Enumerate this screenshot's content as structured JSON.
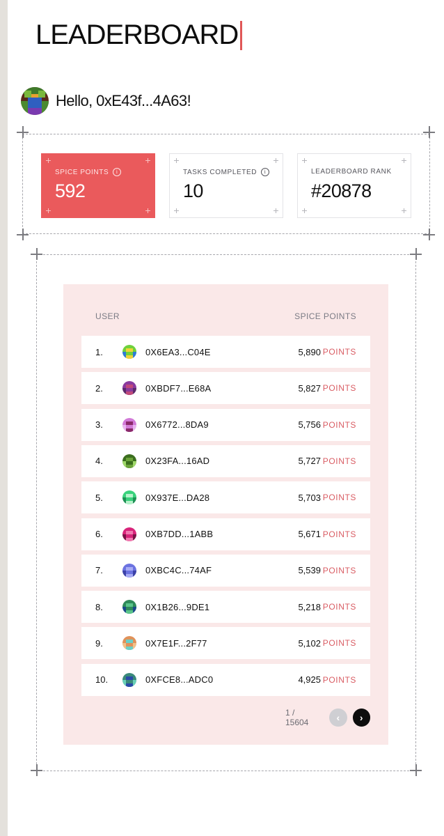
{
  "header": {
    "title": "LEADERBOARD"
  },
  "greeting": {
    "text": "Hello, 0xE43f...4A63!"
  },
  "stats": [
    {
      "label": "SPICE POINTS",
      "value": "592"
    },
    {
      "label": "TASKS COMPLETED",
      "value": "10"
    },
    {
      "label": "LEADERBOARD RANK",
      "value": "#20878"
    }
  ],
  "table": {
    "columns": [
      "USER",
      "SPICE POINTS"
    ],
    "unit": "POINTS",
    "rows": [
      {
        "rank": "1.",
        "user": "0X6EA3...C04E",
        "points": "5,890"
      },
      {
        "rank": "2.",
        "user": "0XBDF7...E68A",
        "points": "5,827"
      },
      {
        "rank": "3.",
        "user": "0X6772...8DA9",
        "points": "5,756"
      },
      {
        "rank": "4.",
        "user": "0X23FA...16AD",
        "points": "5,727"
      },
      {
        "rank": "5.",
        "user": "0X937E...DA28",
        "points": "5,703"
      },
      {
        "rank": "6.",
        "user": "0XB7DD...1ABB",
        "points": "5,671"
      },
      {
        "rank": "7.",
        "user": "0XBC4C...74AF",
        "points": "5,539"
      },
      {
        "rank": "8.",
        "user": "0X1B26...9DE1",
        "points": "5,218"
      },
      {
        "rank": "9.",
        "user": "0X7E1F...2F77",
        "points": "5,102"
      },
      {
        "rank": "10.",
        "user": "0XFCE8...ADC0",
        "points": "4,925"
      }
    ]
  },
  "pagination": {
    "text": "1 / 15604",
    "prev_icon": "chevron-left-icon",
    "next_icon": "chevron-right-icon"
  },
  "colors": {
    "accent": "#ea5a5c",
    "board_bg": "#fae8e8",
    "points_unit": "#d95c63"
  },
  "icons": {
    "info": "info-icon",
    "avatar": "pixel-avatar"
  }
}
